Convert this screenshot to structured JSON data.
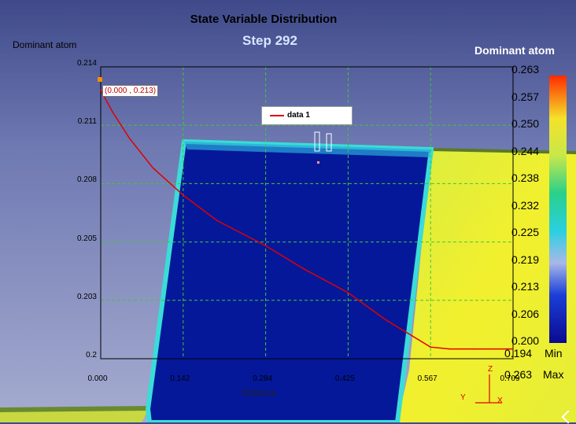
{
  "window": {
    "title": "State Variable Distribution",
    "step_label": "Step  292"
  },
  "plot": {
    "ylabel": "Dominant atom",
    "xlabel": "Distance",
    "yticks": [
      "0.214",
      "0.211",
      "0.208",
      "0.205",
      "0.203",
      "0.2"
    ],
    "xticks": [
      "0.000",
      "0.142",
      "0.284",
      "0.425",
      "0.567",
      "0.709"
    ],
    "legend_label": "data 1",
    "annotation": "(0.000 , 0.213)",
    "line_color": "#e00000"
  },
  "colorbar": {
    "title": "Dominant atom",
    "ticks": [
      "0.263",
      "0.257",
      "0.250",
      "0.244",
      "0.238",
      "0.232",
      "0.225",
      "0.219",
      "0.213",
      "0.206",
      "0.200"
    ],
    "min_value": "0.194",
    "min_label": "Min",
    "max_value": "0.263",
    "max_label": "Max"
  },
  "axes_triad": {
    "x": "X",
    "y": "Y",
    "z": "Z"
  },
  "chart_data": {
    "type": "line",
    "title": "State Variable Distribution",
    "xlabel": "Distance",
    "ylabel": "Dominant atom",
    "xlim": [
      0.0,
      0.709
    ],
    "ylim": [
      0.1995,
      0.2145
    ],
    "grid": true,
    "legend_position": "top-center",
    "series": [
      {
        "name": "data 1",
        "x": [
          0.0,
          0.02,
          0.05,
          0.09,
          0.142,
          0.2,
          0.284,
          0.35,
          0.425,
          0.49,
          0.567,
          0.6,
          0.64,
          0.709
        ],
        "y": [
          0.2133,
          0.2122,
          0.2108,
          0.2093,
          0.2079,
          0.2066,
          0.2053,
          0.2041,
          0.2029,
          0.2015,
          0.2001,
          0.2,
          0.2,
          0.2
        ]
      }
    ]
  }
}
